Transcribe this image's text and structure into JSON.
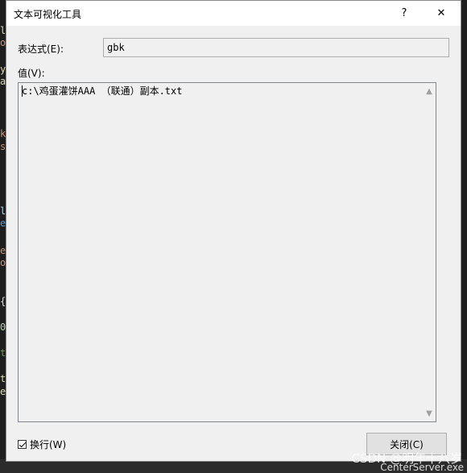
{
  "window": {
    "title": "文本可视化工具",
    "help_glyph": "?",
    "close_glyph": "✕"
  },
  "form": {
    "expression_label": "表达式(E):",
    "expression_value": "gbk",
    "value_label": "值(V):",
    "value_text": "c:\\鸡蛋灌饼AAA （联通）副本.txt",
    "wrap_label": "换行(W)",
    "wrap_checked": true,
    "close_button": "关闭(C)"
  },
  "background": {
    "taskbar_item": "CenterServer.exe",
    "watermark": "CSDN @明年十八岁"
  }
}
